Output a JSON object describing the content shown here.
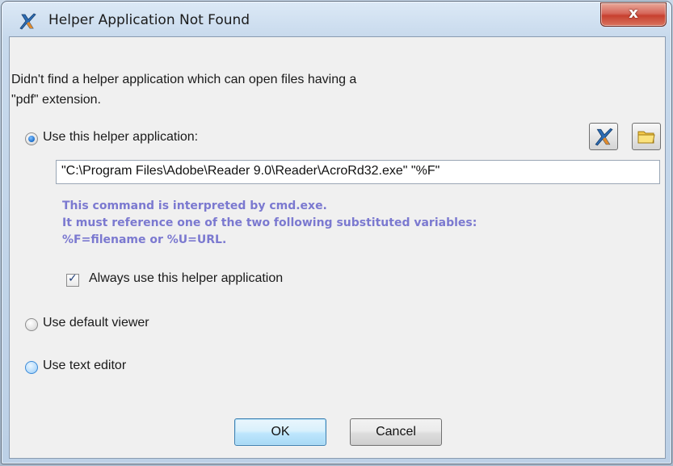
{
  "window": {
    "title": "Helper Application Not Found",
    "close_label": "x"
  },
  "message": {
    "line1": "Didn't find a helper application which can open files having a",
    "line2": "\"pdf\" extension."
  },
  "options": {
    "helper_app_label": "Use this helper application:",
    "default_viewer_label": "Use default viewer",
    "text_editor_label": "Use text editor",
    "selected": "helper_app"
  },
  "command": {
    "value": "\"C:\\Program Files\\Adobe\\Reader 9.0\\Reader\\AcroRd32.exe\" \"%F\""
  },
  "hint": {
    "line1": "This command is interpreted by cmd.exe.",
    "line2": "It must reference one of the two following substituted variables:",
    "line3": "%F=filename or %U=URL."
  },
  "always_use": {
    "label": "Always use this helper application",
    "checked": true
  },
  "buttons": {
    "ok_label": "OK",
    "cancel_label": "Cancel"
  },
  "icons": {
    "app": "app-logo-icon",
    "tool_app": "app-logo-icon",
    "folder": "folder-icon"
  },
  "colors": {
    "hint_text": "#7b79d0",
    "close_button": "#c7402f",
    "default_button": "#3c7fb1"
  }
}
